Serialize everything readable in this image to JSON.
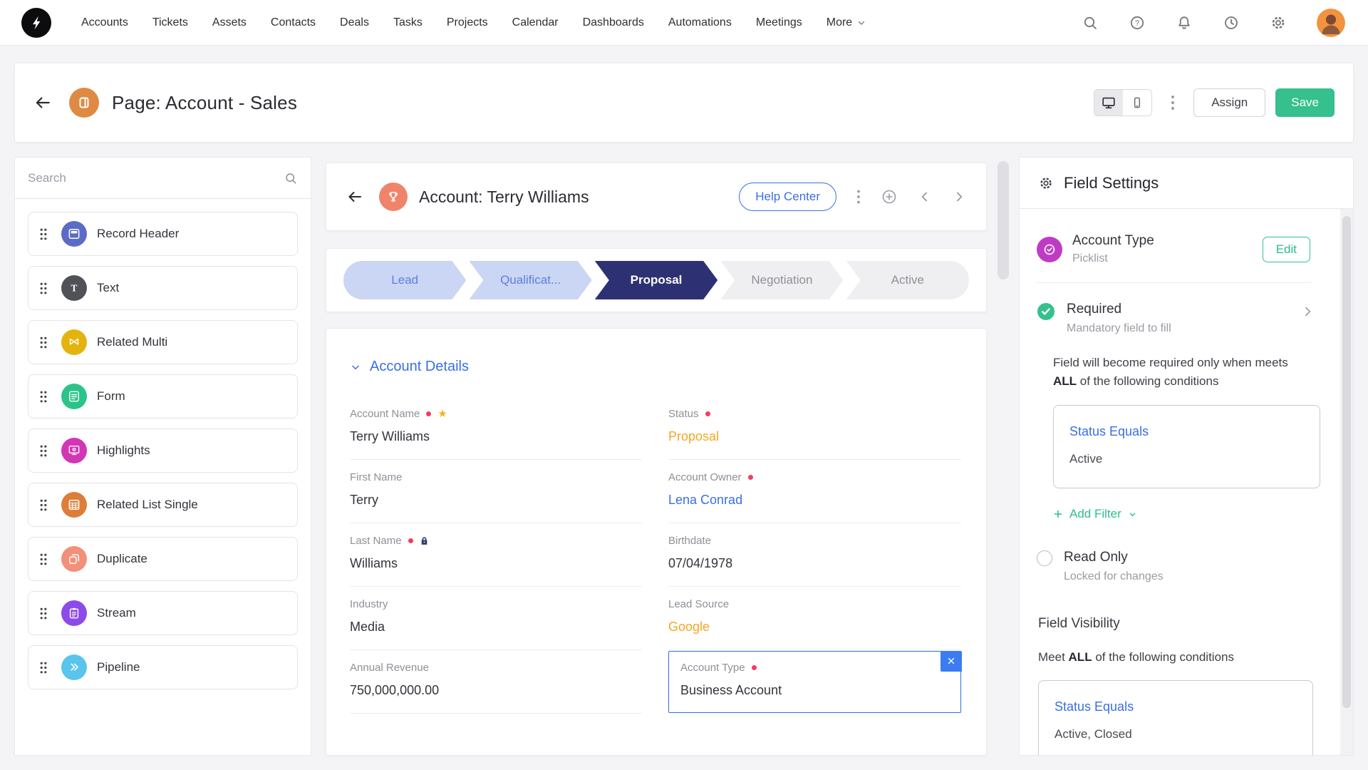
{
  "colors": {
    "accent_green": "#35C08E",
    "link_blue": "#3B6FE0",
    "status_orange": "#F5A623",
    "required_red": "#F23C63",
    "stage_current_navy": "#2D3174",
    "stage_past_blue": "#CBD6F4",
    "selected_field_blue": "#2F6FE0"
  },
  "nav": {
    "items": [
      "Accounts",
      "Tickets",
      "Assets",
      "Contacts",
      "Deals",
      "Tasks",
      "Projects",
      "Calendar",
      "Dashboards",
      "Automations",
      "Meetings"
    ],
    "more_label": "More"
  },
  "page_header": {
    "title": "Page: Account - Sales",
    "assign_label": "Assign",
    "save_label": "Save"
  },
  "sidebar": {
    "search_placeholder": "Search",
    "items": [
      {
        "label": "Record Header",
        "icon": "record-header-icon",
        "color": "#5B6BC6"
      },
      {
        "label": "Text",
        "icon": "text-icon",
        "color": "#515158"
      },
      {
        "label": "Related Multi",
        "icon": "related-multi-icon",
        "color": "#E3B40E"
      },
      {
        "label": "Form",
        "icon": "form-icon",
        "color": "#2BC488"
      },
      {
        "label": "Highlights",
        "icon": "highlights-icon",
        "color": "#D336B4"
      },
      {
        "label": "Related List Single",
        "icon": "related-list-single-icon",
        "color": "#DD7E38"
      },
      {
        "label": "Duplicate",
        "icon": "duplicate-icon",
        "color": "#F29079"
      },
      {
        "label": "Stream",
        "icon": "stream-icon",
        "color": "#8C4BE8"
      },
      {
        "label": "Pipeline",
        "icon": "pipeline-icon",
        "color": "#59C4EC"
      }
    ]
  },
  "record": {
    "title": "Account: Terry Williams",
    "help_center_label": "Help Center",
    "stages": [
      {
        "label": "Lead",
        "state": "past"
      },
      {
        "label": "Qualificat...",
        "state": "past"
      },
      {
        "label": "Proposal",
        "state": "current"
      },
      {
        "label": "Negotiation",
        "state": "upcoming"
      },
      {
        "label": "Active",
        "state": "upcoming"
      }
    ],
    "section_title": "Account Details",
    "fields_left": [
      {
        "label": "Account Name",
        "value": "Terry Williams",
        "required": true,
        "starred": true
      },
      {
        "label": "First Name",
        "value": "Terry"
      },
      {
        "label": "Last Name",
        "value": "Williams",
        "required": true,
        "locked": true
      },
      {
        "label": "Industry",
        "value": "Media"
      },
      {
        "label": "Annual Revenue",
        "value": "750,000,000.00"
      }
    ],
    "fields_right": [
      {
        "label": "Status",
        "value": "Proposal",
        "required": true,
        "value_color": "orange"
      },
      {
        "label": "Account Owner",
        "value": "Lena Conrad",
        "required": true,
        "value_color": "link"
      },
      {
        "label": "Birthdate",
        "value": "07/04/1978"
      },
      {
        "label": "Lead Source",
        "value": "Google",
        "value_color": "orange"
      },
      {
        "label": "Account Type",
        "value": "Business Account",
        "required": true,
        "selected": true
      }
    ]
  },
  "field_settings": {
    "title": "Field Settings",
    "field": {
      "name": "Account Type",
      "type": "Picklist",
      "edit_label": "Edit"
    },
    "required": {
      "label": "Required",
      "description": "Mandatory field to fill",
      "intro_text": "Field will become required only when meets",
      "intro_bold": "ALL",
      "intro_rest": "of the following conditions",
      "condition": {
        "criteria": "Status Equals",
        "values": "Active"
      },
      "add_filter_label": "Add Filter"
    },
    "read_only": {
      "label": "Read Only",
      "description": "Locked for changes"
    },
    "visibility": {
      "title": "Field Visibility",
      "intro_text": "Meet",
      "intro_bold": "ALL",
      "intro_rest": "of the following conditions",
      "condition": {
        "criteria": "Status Equals",
        "values": "Active, Closed"
      }
    }
  }
}
